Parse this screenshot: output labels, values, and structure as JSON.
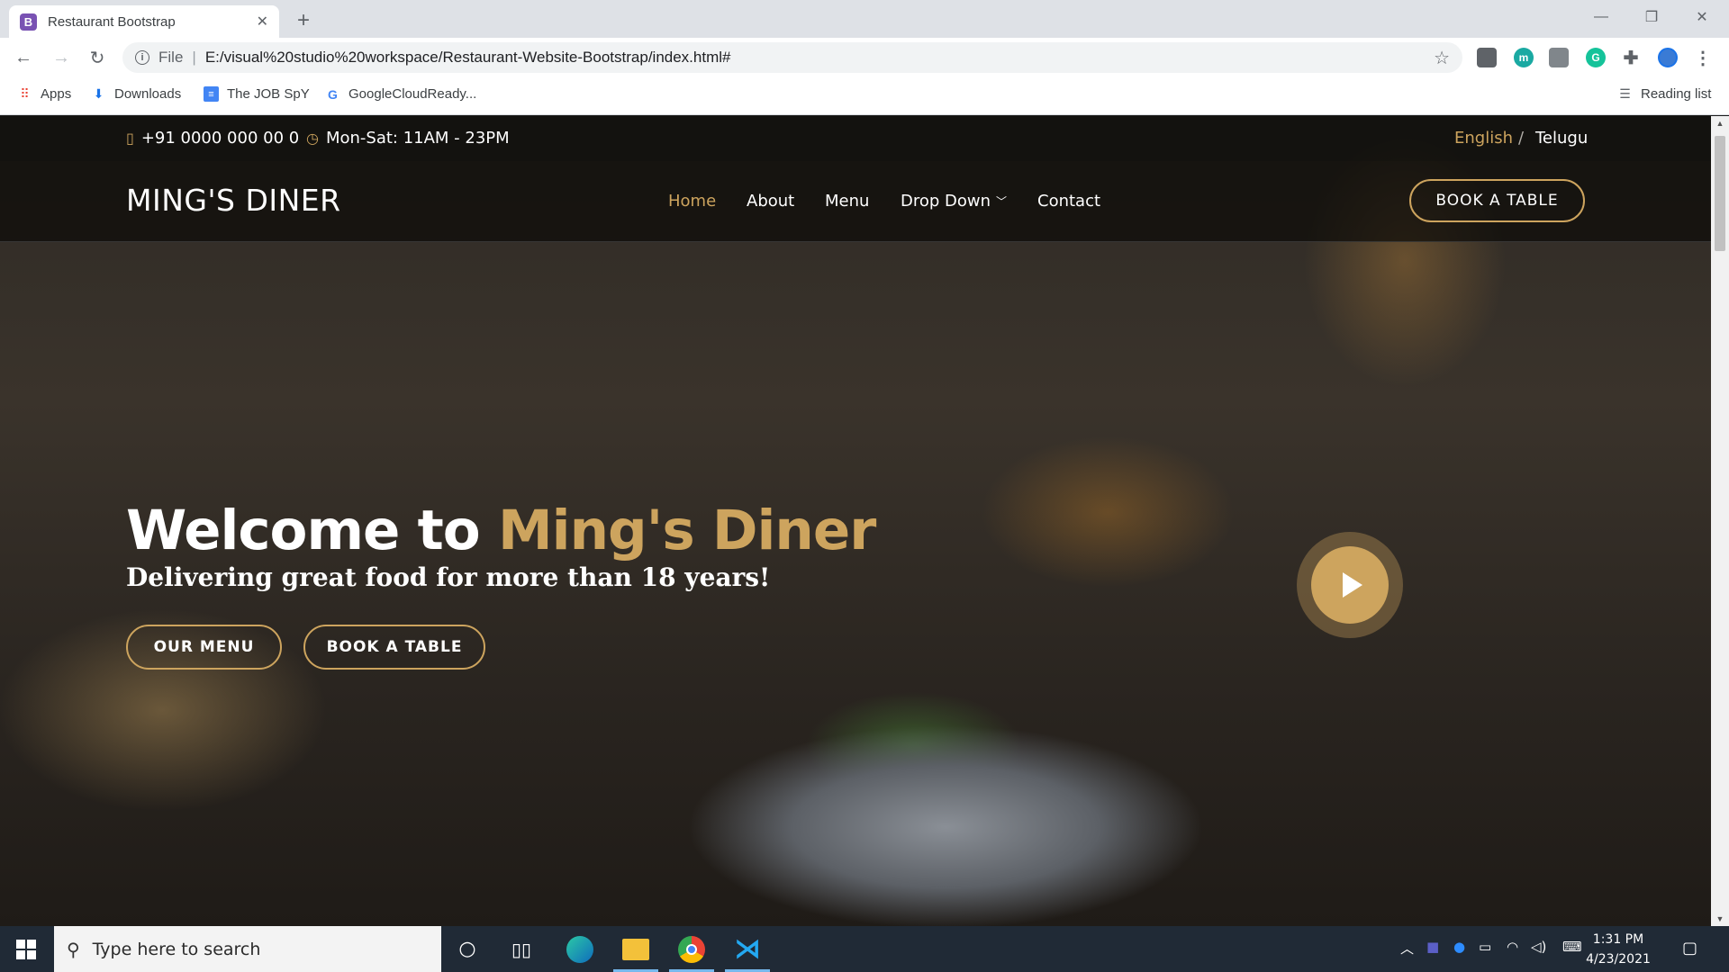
{
  "browser": {
    "tab_title": "Restaurant Bootstrap",
    "tab_favicon_letter": "B",
    "url_scheme": "File",
    "url": "E:/visual%20studio%20workspace/Restaurant-Website-Bootstrap/index.html#",
    "bookmarks": [
      {
        "label": "Apps",
        "icon": "apps-grid-icon"
      },
      {
        "label": "Downloads",
        "icon": "download-icon"
      },
      {
        "label": "The JOB SpY",
        "icon": "docs-icon"
      },
      {
        "label": "GoogleCloudReady...",
        "icon": "google-icon"
      }
    ],
    "reading_list": "Reading list"
  },
  "site": {
    "phone": "+91 0000 000 00 0",
    "hours": "Mon-Sat: 11AM - 23PM",
    "lang_active": "English",
    "lang_sep": "/",
    "lang_other": "Telugu",
    "logo": "MING'S DINER",
    "nav": [
      {
        "label": "Home",
        "active": true
      },
      {
        "label": "About",
        "active": false
      },
      {
        "label": "Menu",
        "active": false
      },
      {
        "label": "Drop Down",
        "active": false
      },
      {
        "label": "Contact",
        "active": false
      }
    ],
    "book_table_header": "BOOK A TABLE",
    "hero": {
      "title_prefix": "Welcome to",
      "title_accent": "Ming's Diner",
      "subtitle": "Delivering great food for more than 18 years!",
      "btn_menu": "OUR MENU",
      "btn_book": "BOOK A TABLE"
    }
  },
  "taskbar": {
    "search_placeholder": "Type here to search",
    "time": "1:31 PM",
    "date": "4/23/2021"
  },
  "colors": {
    "accent": "#cda45e",
    "taskbar": "#202a36"
  }
}
